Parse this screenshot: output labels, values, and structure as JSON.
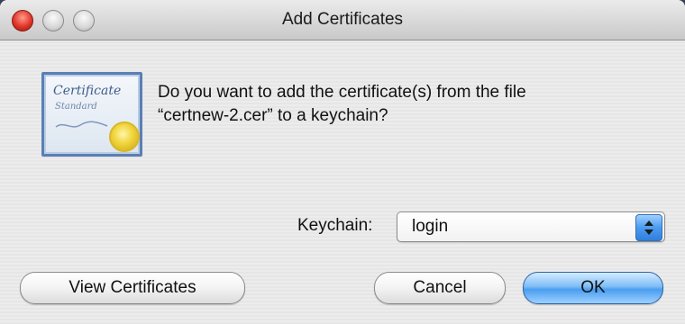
{
  "window": {
    "title": "Add Certificates"
  },
  "icon": {
    "name": "certificate-icon",
    "line1": "Certificate",
    "line2": "Standard"
  },
  "message": {
    "line1": "Do you want to add the certificate(s) from the file",
    "line2": "“certnew-2.cer” to a keychain?"
  },
  "keychain": {
    "label": "Keychain:",
    "selected": "login"
  },
  "buttons": {
    "view_certificates": "View Certificates",
    "cancel": "Cancel",
    "ok": "OK"
  },
  "colors": {
    "default_button": "#4a9ef0",
    "close_button": "#e0362a"
  }
}
